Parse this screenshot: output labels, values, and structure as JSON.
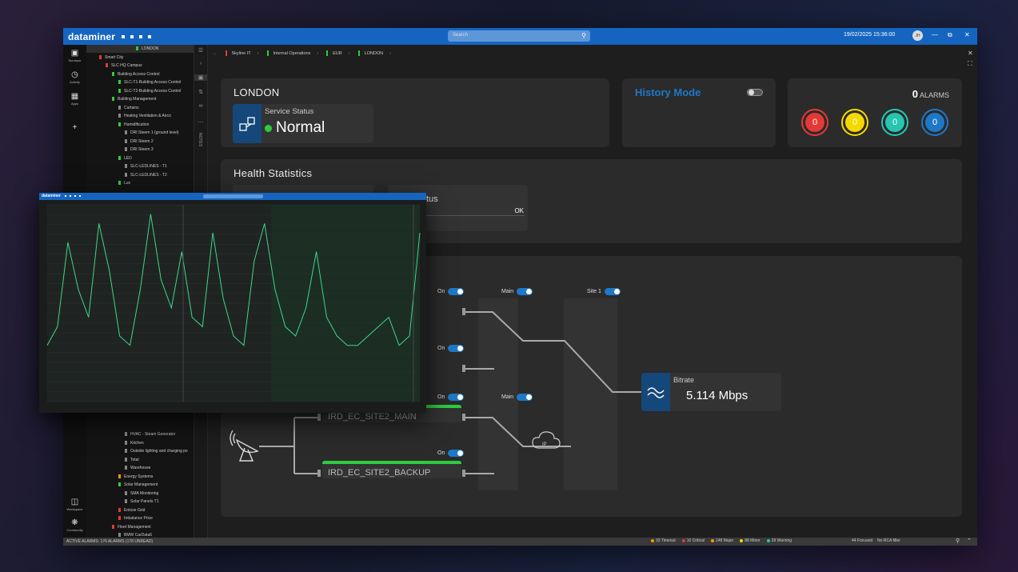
{
  "app": {
    "logo": "dataminer",
    "search_placeholder": "Search",
    "datetime": "19/02/2025 15:36:00",
    "user_initials": "JH"
  },
  "rail": [
    {
      "label": "Surveyor",
      "icon": "surveyor-icon"
    },
    {
      "label": "Activity",
      "icon": "activity-icon"
    },
    {
      "label": "Apps",
      "icon": "apps-icon"
    },
    {
      "label": "Workspace",
      "icon": "workspace-icon"
    },
    {
      "label": "Community",
      "icon": "community-icon"
    }
  ],
  "tree": {
    "items": [
      {
        "label": "LONDON",
        "color": "#2ecc40",
        "indent": 62
      },
      {
        "label": "Smart City",
        "color": "#e53935",
        "indent": 16
      },
      {
        "label": "SLC HQ Campus",
        "color": "#e53935",
        "indent": 24
      },
      {
        "label": "Building Access Control",
        "color": "#2ecc40",
        "indent": 32
      },
      {
        "label": "SLC-T1-Building Access Control",
        "color": "#2ecc40",
        "indent": 40
      },
      {
        "label": "SLC-T2-Building Access Control",
        "color": "#2ecc40",
        "indent": 40
      },
      {
        "label": "Building Management",
        "color": "#2ecc40",
        "indent": 32
      },
      {
        "label": "Curtains",
        "color": "#888888",
        "indent": 40
      },
      {
        "label": "Heating Ventilation & Airco",
        "color": "#888888",
        "indent": 40
      },
      {
        "label": "Humidification",
        "color": "#2ecc40",
        "indent": 40
      },
      {
        "label": "DRI Steem 1 (ground level)",
        "color": "#888888",
        "indent": 48
      },
      {
        "label": "DRI Steem 2",
        "color": "#888888",
        "indent": 48
      },
      {
        "label": "DRI Steem 3",
        "color": "#888888",
        "indent": 48
      },
      {
        "label": "LED",
        "color": "#2ecc40",
        "indent": 40
      },
      {
        "label": "SLC-LEDLINES - T1",
        "color": "#888888",
        "indent": 48
      },
      {
        "label": "SLC-LEDLINES - T2",
        "color": "#888888",
        "indent": 48
      },
      {
        "label": "Lux",
        "color": "#2ecc40",
        "indent": 40
      }
    ],
    "items_lower": [
      {
        "label": "HVAC - Steam Generator",
        "color": "#888888",
        "indent": 48
      },
      {
        "label": "Kitchen",
        "color": "#888888",
        "indent": 48
      },
      {
        "label": "Outside lighting and charging po",
        "color": "#888888",
        "indent": 48
      },
      {
        "label": "Total",
        "color": "#888888",
        "indent": 48
      },
      {
        "label": "Warehouse",
        "color": "#888888",
        "indent": 48
      },
      {
        "label": "Energy Systems",
        "color": "#ff9800",
        "indent": 40
      },
      {
        "label": "Solar Management",
        "color": "#2ecc40",
        "indent": 40
      },
      {
        "label": "SMA Monitoring",
        "color": "#888888",
        "indent": 48
      },
      {
        "label": "Solar Panels T1",
        "color": "#888888",
        "indent": 48
      },
      {
        "label": "Entsoe Grid",
        "color": "#e53935",
        "indent": 40
      },
      {
        "label": "Imbalance Price",
        "color": "#e53935",
        "indent": 40
      },
      {
        "label": "Fleet Management",
        "color": "#e53935",
        "indent": 32
      },
      {
        "label": "BMW CarData6",
        "color": "#888888",
        "indent": 40
      },
      {
        "label": "BMW CarData9",
        "color": "#888888",
        "indent": 40
      }
    ]
  },
  "side2": {
    "notes_label": "NOTES"
  },
  "breadcrumb": [
    {
      "label": "Skyline IT",
      "color": "#e53935"
    },
    {
      "label": "Internal Operations",
      "color": "#2ecc40"
    },
    {
      "label": "EUR",
      "color": "#2ecc40"
    },
    {
      "label": "LONDON",
      "color": "#2ecc40"
    }
  ],
  "service": {
    "title": "LONDON",
    "status_label": "Service Status",
    "status_value": "Normal"
  },
  "history": {
    "label": "History Mode"
  },
  "alarms": {
    "count": "0",
    "label": "ALARMS",
    "circles": [
      {
        "value": "0",
        "color": "#e53935"
      },
      {
        "value": "0",
        "color": "#f5d800"
      },
      {
        "value": "0",
        "color": "#26c6b0"
      },
      {
        "value": "0",
        "color": "#1e78c8"
      }
    ]
  },
  "health": {
    "title": "Health Statistics",
    "status_label": "tus",
    "status_value": "OK"
  },
  "flow": {
    "on_label": "On",
    "main_label": "Main",
    "site_label": "Site 1",
    "node_main": "IRD_EC_SITE2_MAIN",
    "node_backup": "IRD_EC_SITE2_BACKUP",
    "ip_label": "IP",
    "bitrate_label": "Bitrate",
    "bitrate_value": "5.114 Mbps"
  },
  "statusbar": {
    "active_alarms": "ACTIVE ALARMS: 176 ALARMS (178 UNREAD)",
    "counts": [
      {
        "label": "33 Timeout",
        "color": "#ff9800"
      },
      {
        "label": "10 Critical",
        "color": "#e53935"
      },
      {
        "label": "248 Major",
        "color": "#ff9800"
      },
      {
        "label": "88 Minor",
        "color": "#f5d800"
      },
      {
        "label": "39 Warning",
        "color": "#26c6b0"
      }
    ],
    "focused": "44 Focused",
    "rca": "No RCA filter"
  },
  "overlay": {
    "logo": "dataminer",
    "chart_data": {
      "type": "line",
      "title": "",
      "xlabel": "",
      "ylabel": "",
      "series": [
        {
          "values": [
            30,
            40,
            85,
            60,
            45,
            95,
            70,
            35,
            30,
            60,
            100,
            65,
            50,
            80,
            45,
            40,
            90,
            55,
            35,
            30,
            75,
            95,
            60,
            40,
            35,
            50,
            80,
            45,
            35,
            30,
            30,
            35,
            40,
            45,
            30,
            35,
            90
          ]
        }
      ]
    }
  }
}
